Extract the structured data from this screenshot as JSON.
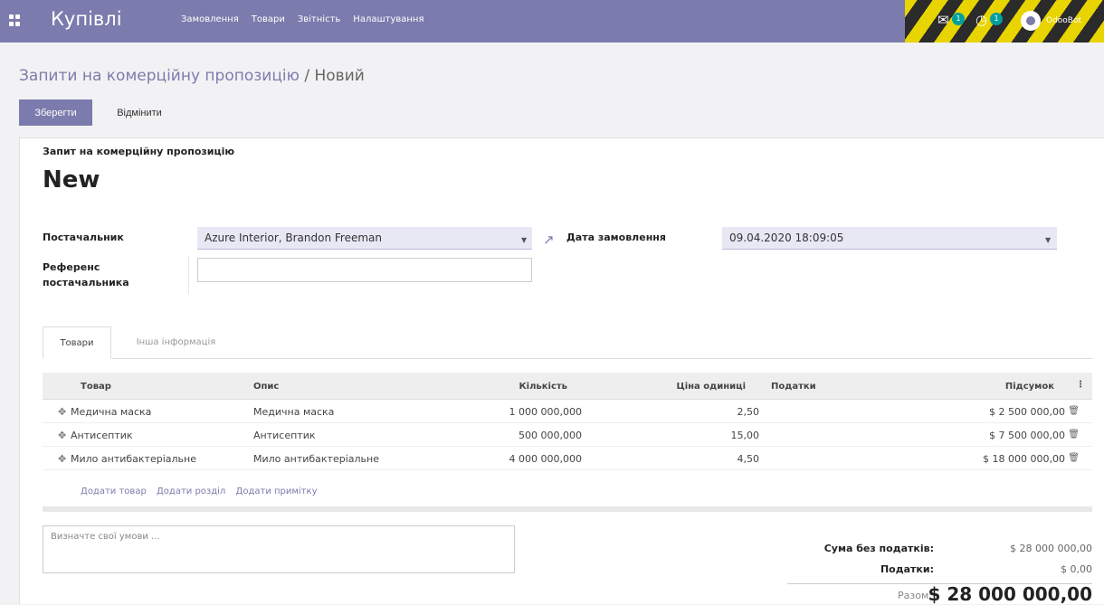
{
  "navbar": {
    "app_name": "Купівлі",
    "menu": [
      "Замовлення",
      "Товари",
      "Звітність",
      "Налаштування"
    ],
    "chat_count": "1",
    "activity_count": "1",
    "user_name": "OdooBot",
    "bar_color": "#7c7bad"
  },
  "breadcrumb": {
    "parent": "Запити на комерційну пропозицію",
    "separator": "/",
    "current": "Новий"
  },
  "buttons": {
    "save": "Зберегти",
    "discard": "Відмінити"
  },
  "form": {
    "doc_kind": "Запит на комерційну пропозицію",
    "doc_name": "New",
    "vendor_label": "Постачальник",
    "vendor_value": "Azure Interior, Brandon Freeman",
    "vendor_ref_label_1": "Референс",
    "vendor_ref_label_2": "постачальника",
    "vendor_ref_value": "",
    "order_date_label": "Дата замовлення",
    "order_date_value": "09.04.2020 18:09:05"
  },
  "tabs": [
    "Товари",
    "Інша інформація"
  ],
  "table": {
    "columns": [
      "Товар",
      "Опис",
      "Кількість",
      "Ціна одиниці",
      "Податки",
      "Підсумок"
    ],
    "rows": [
      {
        "product": "Медична маска",
        "description": "Медична маска",
        "qty": "1 000 000,000",
        "price": "2,50",
        "taxes": "",
        "subtotal": "$ 2 500 000,00"
      },
      {
        "product": "Антисептик",
        "description": "Антисептик",
        "qty": "500 000,000",
        "price": "15,00",
        "taxes": "",
        "subtotal": "$ 7 500 000,00"
      },
      {
        "product": "Мило антибактеріальне",
        "description": "Мило антибактеріальне",
        "qty": "4 000 000,000",
        "price": "4,50",
        "taxes": "",
        "subtotal": "$ 18 000 000,00"
      }
    ],
    "add_links": [
      "Додати товар",
      "Додати розділ",
      "Додати примітку"
    ]
  },
  "notes_placeholder": "Визначте свої умови ...",
  "totals": {
    "untaxed_label": "Сума без податків:",
    "untaxed_value": "$ 28 000 000,00",
    "taxes_label": "Податки:",
    "taxes_value": "$ 0,00",
    "total_label": "Разом:",
    "total_value": "$ 28 000 000,00"
  },
  "icons": {
    "apps": "apps-grid-icon",
    "chat": "chat-icon",
    "activity": "clock-icon",
    "external": "external-link-icon",
    "drag": "drag-handle-icon",
    "delete": "trash-icon",
    "dropdown": "caret-down-icon",
    "optional_columns": "kebab-icon"
  }
}
